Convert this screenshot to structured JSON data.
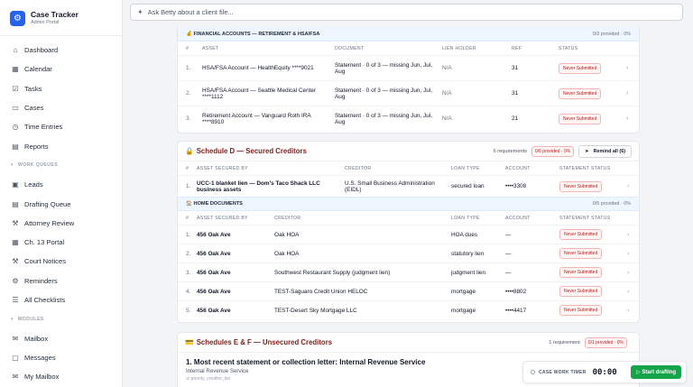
{
  "brand": {
    "title": "Case Tracker",
    "subtitle": "Admin Portal"
  },
  "sidebar": {
    "items": [
      {
        "label": "Dashboard",
        "icon": "home-icon",
        "glyph": "⌂"
      },
      {
        "label": "Calendar",
        "icon": "calendar-icon",
        "glyph": "▦"
      },
      {
        "label": "Tasks",
        "icon": "checkbox-icon",
        "glyph": "☑"
      },
      {
        "label": "Cases",
        "icon": "folder-icon",
        "glyph": "▭"
      },
      {
        "label": "Time Entries",
        "icon": "clock-icon",
        "glyph": "◷"
      },
      {
        "label": "Reports",
        "icon": "document-icon",
        "glyph": "▤"
      }
    ],
    "section_work": "WORK QUEUES",
    "work_items": [
      {
        "label": "Leads",
        "icon": "leads-icon",
        "glyph": "▣"
      },
      {
        "label": "Drafting Queue",
        "icon": "draft-icon",
        "glyph": "▤"
      },
      {
        "label": "Attorney Review",
        "icon": "gavel-icon",
        "glyph": "⚒"
      },
      {
        "label": "Ch. 13 Portal",
        "icon": "portal-icon",
        "glyph": "▦"
      },
      {
        "label": "Court Notices",
        "icon": "gavel-icon",
        "glyph": "⚒"
      },
      {
        "label": "Reminders",
        "icon": "gear-icon",
        "glyph": "⚙"
      },
      {
        "label": "All Checklists",
        "icon": "checklist-icon",
        "glyph": "☰"
      }
    ],
    "section_modules": "MODULES",
    "module_items": [
      {
        "label": "Mailbox",
        "icon": "inbox-icon",
        "glyph": "✉"
      },
      {
        "label": "Messages",
        "icon": "chat-icon",
        "glyph": "▢"
      },
      {
        "label": "My Mailbox",
        "icon": "mail-icon",
        "glyph": "✉"
      }
    ]
  },
  "search": {
    "placeholder": "Ask Betty about a client file..."
  },
  "financial": {
    "title": "FINANCIAL ACCOUNTS — RETIREMENT & HSA/FSA",
    "progress": "0/3 provided · 0%",
    "headers": [
      "#",
      "ASSET",
      "DOCUMENT",
      "LIEN HOLDER",
      "REF",
      "STATUS"
    ],
    "rows": [
      {
        "num": "1.",
        "asset": "HSA/FSA Account — HealthEquity ****9021",
        "document": "Statement · 0 of 3 — missing Jun, Jul, Aug",
        "lien": "N/A",
        "ref": "31",
        "status": "Never Submitted"
      },
      {
        "num": "2.",
        "asset": "HSA/FSA Account — Seattle Medical Center ****1112",
        "document": "Statement · 0 of 3 — missing Jun, Jul, Aug",
        "lien": "N/A",
        "ref": "31",
        "status": "Never Submitted"
      },
      {
        "num": "3.",
        "asset": "Retirement Account — Vanguard Roth IRA ****8910",
        "document": "Statement · 0 of 3 — missing Jun, Jul, Aug",
        "lien": "N/A",
        "ref": "21",
        "status": "Never Submitted"
      }
    ]
  },
  "scheduleD": {
    "title": "Schedule D — Secured Creditors",
    "requirements": "6 requirements",
    "provided": "0/6 provided · 0%",
    "remind": "Remind all (6)",
    "headers": [
      "#",
      "ASSET SECURED BY",
      "CREDITOR",
      "LOAN TYPE",
      "ACCOUNT",
      "STATEMENT STATUS"
    ],
    "rows": [
      {
        "num": "1.",
        "asset": "UCC-1 blanket lien — Dom's Taco Shack LLC business assets",
        "creditor": "U.S. Small Business Administration (EIDL)",
        "loan": "secured loan",
        "account": "••••3308",
        "status": "Never Submitted"
      }
    ],
    "home": {
      "title": "HOME DOCUMENTS",
      "progress": "0/5 provided · 0%",
      "headers": [
        "#",
        "ASSET SECURED BY",
        "CREDITOR",
        "LOAN TYPE",
        "ACCOUNT",
        "STATEMENT STATUS"
      ],
      "rows": [
        {
          "num": "1.",
          "asset": "456 Oak Ave",
          "creditor": "Oak HOA",
          "loan": "HOA dues",
          "account": "—",
          "status": "Never Submitted"
        },
        {
          "num": "2.",
          "asset": "456 Oak Ave",
          "creditor": "Oak HOA",
          "loan": "statutory lien",
          "account": "—",
          "status": "Never Submitted"
        },
        {
          "num": "3.",
          "asset": "456 Oak Ave",
          "creditor": "Southwest Restaurant Supply (judgment lien)",
          "loan": "judgment lien",
          "account": "—",
          "status": "Never Submitted"
        },
        {
          "num": "4.",
          "asset": "456 Oak Ave",
          "creditor": "TEST-Saguaro Credit Union HELOC",
          "loan": "mortgage",
          "account": "••••8802",
          "status": "Never Submitted"
        },
        {
          "num": "5.",
          "asset": "456 Oak Ave",
          "creditor": "TEST-Desert Sky Mortgage LLC",
          "loan": "mortgage",
          "account": "••••4417",
          "status": "Never Submitted"
        }
      ]
    }
  },
  "scheduleEF": {
    "title": "Schedules E & F — Unsecured Creditors",
    "requirements": "1 requirement",
    "provided": "0/1 provided · 0%",
    "item_num": "1.",
    "item_title": "Most recent statement or collection letter: Internal Revenue Service",
    "item_sub": "Internal Revenue Service",
    "item_tag": "priority_creditor_list"
  },
  "timer": {
    "label": "CASE WORK TIMER",
    "time": "00:00",
    "start": "Start drafting"
  },
  "colors": {
    "accent": "#2563eb",
    "danger": "#b91c1c",
    "success": "#16a34a"
  }
}
